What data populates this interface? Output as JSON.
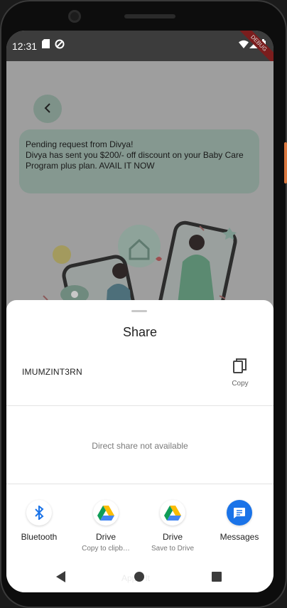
{
  "status_bar": {
    "time": "12:31",
    "debug_banner": "DEBUG"
  },
  "app": {
    "back_icon": "arrow-back-icon",
    "banner_text": "Pending request from Divya!\nDivya has sent you $200/- off discount on your Baby Care Program plus plan. AVAIL IT NOW"
  },
  "share_sheet": {
    "title": "Share",
    "code": "IMUMZINT3RN",
    "copy_label": "Copy",
    "direct_share_text": "Direct share not available",
    "targets": [
      {
        "label": "Bluetooth",
        "sublabel": "",
        "icon": "bluetooth-icon"
      },
      {
        "label": "Drive",
        "sublabel": "Copy to clipb…",
        "icon": "google-drive-icon"
      },
      {
        "label": "Drive",
        "sublabel": "Save to Drive",
        "icon": "google-drive-icon"
      },
      {
        "label": "Messages",
        "sublabel": "",
        "icon": "messages-icon"
      }
    ]
  },
  "nav_bar": {
    "ghost_text": "Apply It"
  },
  "colors": {
    "accent": "#1a73e8",
    "banner_bg": "#859890",
    "side_button": "#d9773f"
  }
}
